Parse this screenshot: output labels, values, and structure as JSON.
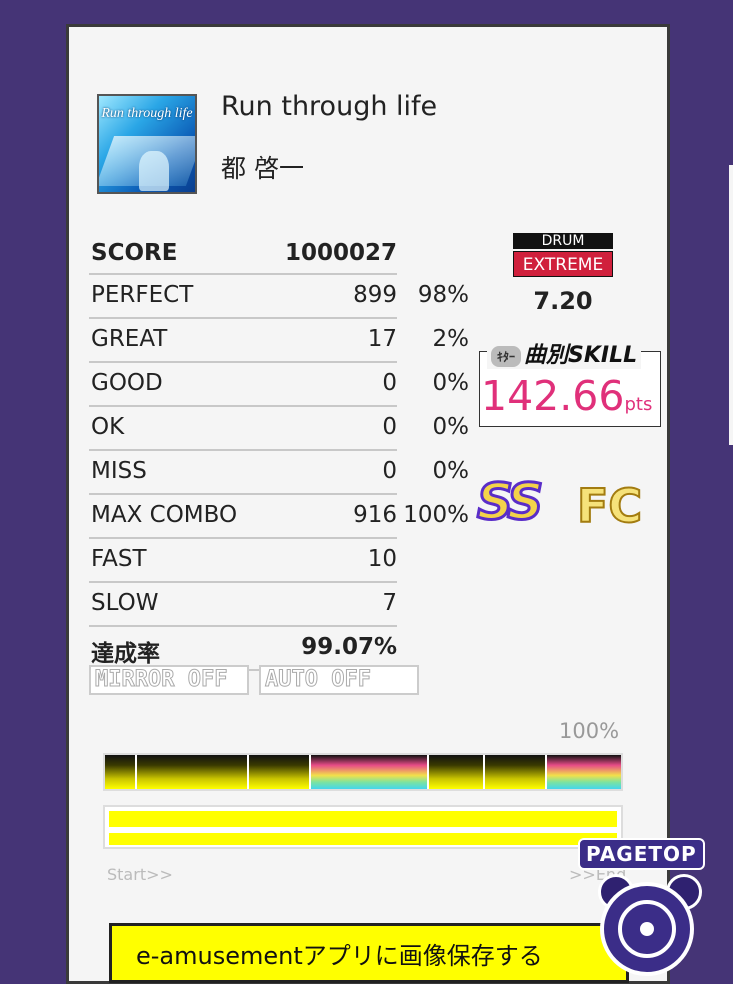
{
  "song": {
    "title": "Run through life",
    "artist": "都 啓一",
    "jacket_text": "Run through life"
  },
  "stats": {
    "score_label": "SCORE",
    "score": "1000027",
    "perfect_label": "PERFECT",
    "perfect": "899",
    "perfect_pct": "98%",
    "great_label": "GREAT",
    "great": "17",
    "great_pct": "2%",
    "good_label": "GOOD",
    "good": "0",
    "good_pct": "0%",
    "ok_label": "OK",
    "ok": "0",
    "ok_pct": "0%",
    "miss_label": "MISS",
    "miss": "0",
    "miss_pct": "0%",
    "combo_label": "MAX COMBO",
    "combo": "916",
    "combo_pct": "100%",
    "fast_label": "FAST",
    "fast": "10",
    "slow_label": "SLOW",
    "slow": "7",
    "achieve_label": "達成率",
    "achieve": "99.07%"
  },
  "options": {
    "mirror": "MIRROR OFF",
    "auto": "AUTO OFF"
  },
  "difficulty": {
    "instrument": "DRUM",
    "level_name": "EXTREME",
    "level": "7.20",
    "color": "#d0203c"
  },
  "skill": {
    "badge": "ｷﾀｰ",
    "label": "曲別SKILL",
    "value": "142.66",
    "unit": "pts",
    "color": "#e0307a"
  },
  "rank": {
    "grade": "SS",
    "clear": "FC"
  },
  "progress": {
    "percent_label": "100%",
    "start_label": "Start>>",
    "end_label": ">>End",
    "segments": [
      "yellow",
      "yellow",
      "yellow",
      "rainbow",
      "yellow",
      "yellow",
      "rainbow"
    ]
  },
  "save_button": {
    "label": "e-amusementアプリに画像保存する"
  },
  "pagetop": {
    "label": "PAGETOP"
  }
}
